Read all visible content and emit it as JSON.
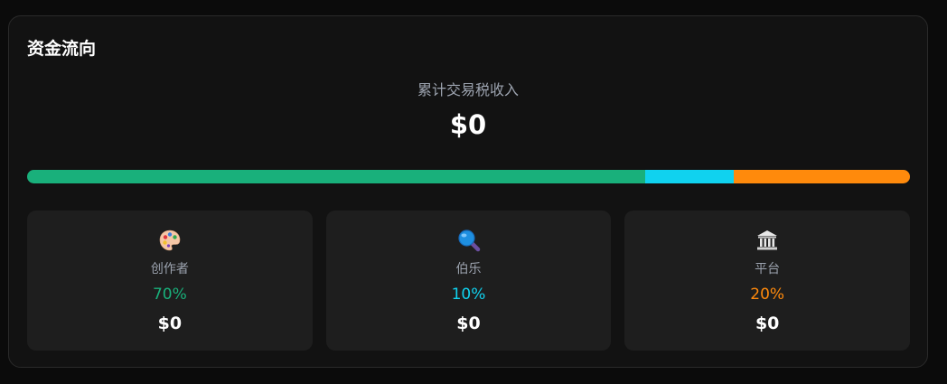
{
  "panel": {
    "title": "资金流向",
    "summary_label": "累计交易税收入",
    "summary_value": "$0"
  },
  "distribution": {
    "segments": [
      {
        "name": "创作者",
        "percent": 70,
        "color": "#19b07b"
      },
      {
        "name": "伯乐",
        "percent": 10,
        "color": "#10d2ef"
      },
      {
        "name": "平台",
        "percent": 20,
        "color": "#ff8a0c"
      }
    ]
  },
  "splits": [
    {
      "icon": "palette-icon",
      "name": "创作者",
      "percent_label": "70%",
      "amount": "$0",
      "color": "#19b07b"
    },
    {
      "icon": "magnifier-icon",
      "name": "伯乐",
      "percent_label": "10%",
      "amount": "$0",
      "color": "#10d2ef"
    },
    {
      "icon": "bank-icon",
      "name": "平台",
      "percent_label": "20%",
      "amount": "$0",
      "color": "#ff8a0c"
    }
  ]
}
